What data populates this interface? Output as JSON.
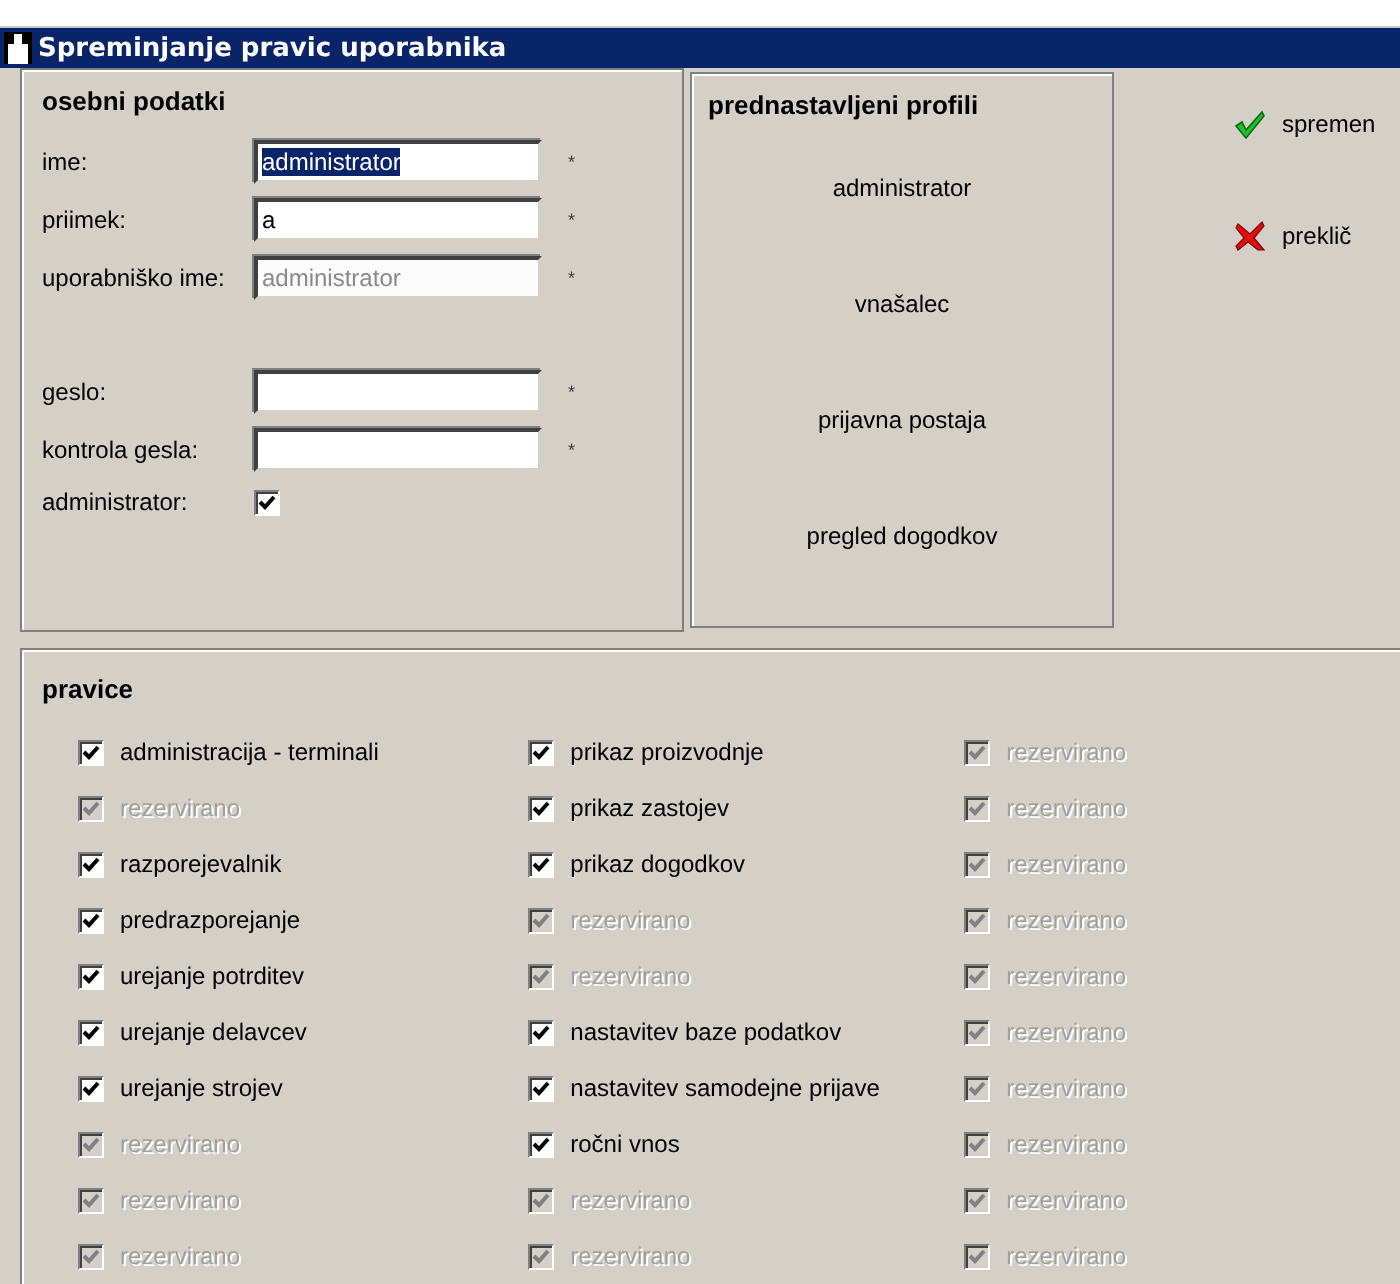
{
  "window": {
    "title": "Spreminjanje pravic uporabnika"
  },
  "personal": {
    "heading": "osebni podatki",
    "fields": [
      {
        "label": "ime:",
        "value": "administrator",
        "selected": true,
        "disabled": false,
        "required": "*"
      },
      {
        "label": "priimek:",
        "value": "a",
        "selected": false,
        "disabled": false,
        "required": "*"
      },
      {
        "label": "uporabniško ime:",
        "value": "administrator",
        "selected": false,
        "disabled": true,
        "required": "*"
      }
    ],
    "password_fields": [
      {
        "label": "geslo:",
        "required": "*"
      },
      {
        "label": "kontrola gesla:",
        "required": "*"
      }
    ],
    "admin": {
      "label": "administrator:",
      "checked": true
    }
  },
  "profiles": {
    "heading": "prednastavljeni profili",
    "items": [
      "administrator",
      "vnašalec",
      "prijavna postaja",
      "pregled dogodkov"
    ]
  },
  "actions": [
    {
      "kind": "confirm",
      "label": "spremen"
    },
    {
      "kind": "cancel",
      "label": "preklič"
    }
  ],
  "rights": {
    "heading": "pravice",
    "columns": [
      [
        {
          "label": "administracija - terminali",
          "checked": true,
          "disabled": false
        },
        {
          "label": "rezervirano",
          "checked": true,
          "disabled": true
        },
        {
          "label": "razporejevalnik",
          "checked": true,
          "disabled": false
        },
        {
          "label": "predrazporejanje",
          "checked": true,
          "disabled": false
        },
        {
          "label": "urejanje potrditev",
          "checked": true,
          "disabled": false
        },
        {
          "label": "urejanje delavcev",
          "checked": true,
          "disabled": false
        },
        {
          "label": "urejanje strojev",
          "checked": true,
          "disabled": false
        },
        {
          "label": "rezervirano",
          "checked": true,
          "disabled": true
        },
        {
          "label": "rezervirano",
          "checked": true,
          "disabled": true
        },
        {
          "label": "rezervirano",
          "checked": true,
          "disabled": true
        }
      ],
      [
        {
          "label": "prikaz proizvodnje",
          "checked": true,
          "disabled": false
        },
        {
          "label": "prikaz zastojev",
          "checked": true,
          "disabled": false
        },
        {
          "label": "prikaz dogodkov",
          "checked": true,
          "disabled": false
        },
        {
          "label": "rezervirano",
          "checked": true,
          "disabled": true
        },
        {
          "label": "rezervirano",
          "checked": true,
          "disabled": true
        },
        {
          "label": "nastavitev baze podatkov",
          "checked": true,
          "disabled": false
        },
        {
          "label": "nastavitev samodejne prijave",
          "checked": true,
          "disabled": false
        },
        {
          "label": "ročni vnos",
          "checked": true,
          "disabled": false
        },
        {
          "label": "rezervirano",
          "checked": true,
          "disabled": true
        },
        {
          "label": "rezervirano",
          "checked": true,
          "disabled": true
        }
      ],
      [
        {
          "label": "rezervirano",
          "checked": true,
          "disabled": true
        },
        {
          "label": "rezervirano",
          "checked": true,
          "disabled": true
        },
        {
          "label": "rezervirano",
          "checked": true,
          "disabled": true
        },
        {
          "label": "rezervirano",
          "checked": true,
          "disabled": true
        },
        {
          "label": "rezervirano",
          "checked": true,
          "disabled": true
        },
        {
          "label": "rezervirano",
          "checked": true,
          "disabled": true
        },
        {
          "label": "rezervirano",
          "checked": true,
          "disabled": true
        },
        {
          "label": "rezervirano",
          "checked": true,
          "disabled": true
        },
        {
          "label": "rezervirano",
          "checked": true,
          "disabled": true
        },
        {
          "label": "rezervirano",
          "checked": true,
          "disabled": true
        }
      ]
    ]
  }
}
